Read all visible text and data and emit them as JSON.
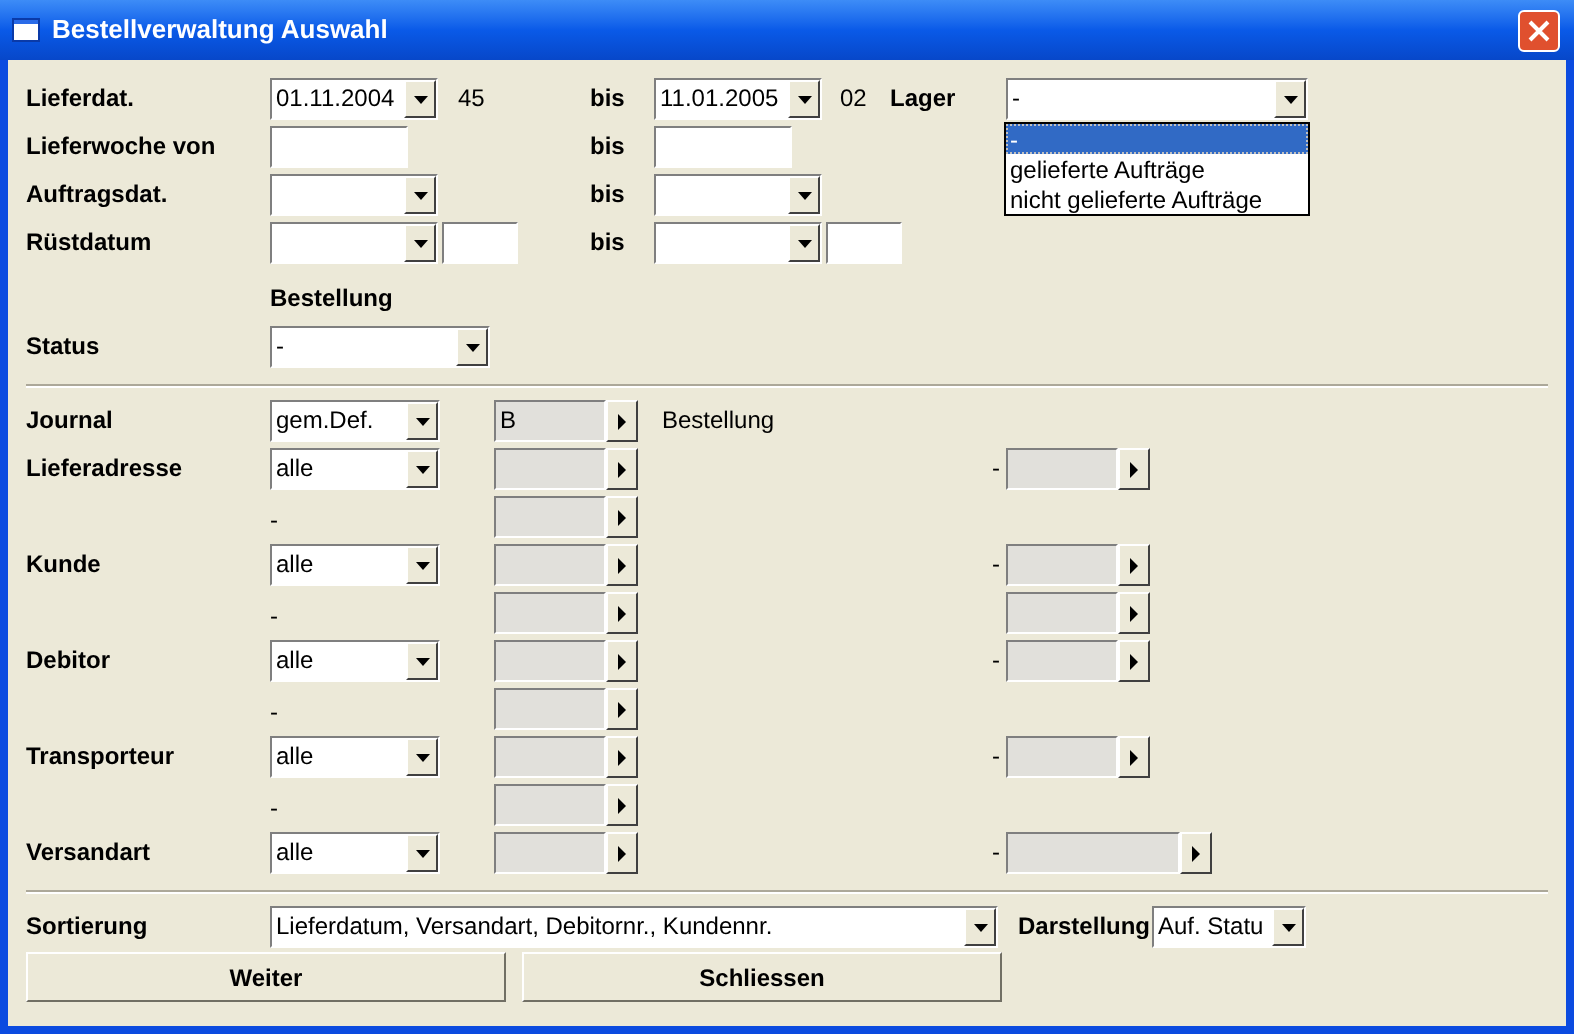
{
  "window": {
    "title": "Bestellverwaltung Auswahl"
  },
  "date_rows": [
    {
      "label": "Lieferdat.",
      "from": {
        "kind": "combo",
        "value": "01.11.2004"
      },
      "from_week": "45",
      "to_label": "bis",
      "to": {
        "kind": "combo",
        "value": "11.01.2005"
      },
      "to_week": "02"
    },
    {
      "label": "Lieferwoche von",
      "from": {
        "kind": "field"
      },
      "to_label": "bis",
      "to": {
        "kind": "field"
      }
    },
    {
      "label": "Auftragsdat.",
      "from": {
        "kind": "combo"
      },
      "to_label": "bis",
      "to": {
        "kind": "combo"
      }
    },
    {
      "label": "Rüstdatum",
      "from": {
        "kind": "combotime"
      },
      "to_label": "bis",
      "to": {
        "kind": "combotime"
      }
    }
  ],
  "lager": {
    "label": "Lager",
    "value": "-",
    "expanded": true,
    "options": [
      {
        "label": "-",
        "selected": true
      },
      {
        "label": "gelieferte Aufträge",
        "selected": false
      },
      {
        "label": "nicht gelieferte Aufträge",
        "selected": false
      }
    ]
  },
  "section_heading": "Bestellung",
  "status": {
    "label": "Status",
    "value": "-"
  },
  "filters": [
    {
      "label": "Journal",
      "mode": "gem.Def.",
      "from_value": "B",
      "note": "Bestellung"
    },
    {
      "label": "Lieferadresse",
      "mode": "alle",
      "to_dash": "-",
      "second": {
        "dash": "-"
      }
    },
    {
      "label": "Kunde",
      "mode": "alle",
      "to_dash": "-",
      "second": {
        "dash": "-",
        "right_lookup": true
      }
    },
    {
      "label": "Debitor",
      "mode": "alle",
      "to_dash": "-",
      "second": {
        "dash": "-"
      }
    },
    {
      "label": "Transporteur",
      "mode": "alle",
      "to_dash": "-",
      "second": {
        "dash": "-"
      }
    },
    {
      "label": "Versandart",
      "mode": "alle",
      "to_dash": "-",
      "to_wide": true
    }
  ],
  "sorting": {
    "label": "Sortierung",
    "value": "Lieferdatum, Versandart, Debitornr., Kundennr."
  },
  "display": {
    "label": "Darstellung",
    "value": "Auf. Statu"
  },
  "buttons": [
    "Weiter",
    "Schliessen"
  ]
}
